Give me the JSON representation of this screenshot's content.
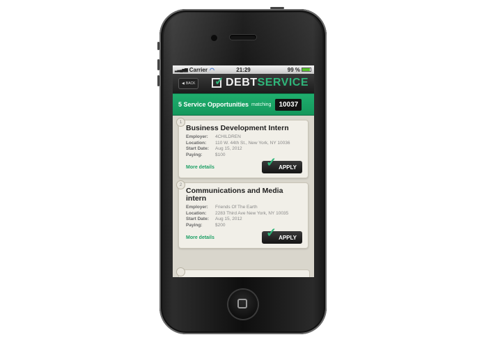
{
  "status_bar": {
    "carrier": "Carrier",
    "time": "21:29",
    "battery": "99 %"
  },
  "nav": {
    "back_label": "BACK",
    "logo_debt": "DEBT",
    "logo_service": "SERVICE"
  },
  "banner": {
    "count_text": "5 Service Opportunities",
    "matching_text": "matching",
    "zip": "10037"
  },
  "labels": {
    "employer": "Employer:",
    "location": "Location:",
    "start_date": "Start Date:",
    "paying": "Paying:",
    "more_details": "More details",
    "apply": "APPLY"
  },
  "opportunities": [
    {
      "number": "1",
      "title": "Business Development Intern",
      "employer": "4CHILDREN",
      "location": "110 W. 44th St., New York, NY 10036",
      "start_date": "Aug 15, 2012",
      "paying": "$100"
    },
    {
      "number": "2",
      "title": "Communications and Media intern",
      "employer": "Friends Of The Earth",
      "location": "2283 Third Ave New York, NY 10035",
      "start_date": "Aug 15, 2012",
      "paying": "$200"
    }
  ],
  "colors": {
    "accent": "#1fae6e",
    "dark": "#1c1c1c"
  },
  "icons": {
    "back": "chevron-left-icon",
    "logo": "checkbox-icon",
    "apply": "checkmark-icon"
  }
}
